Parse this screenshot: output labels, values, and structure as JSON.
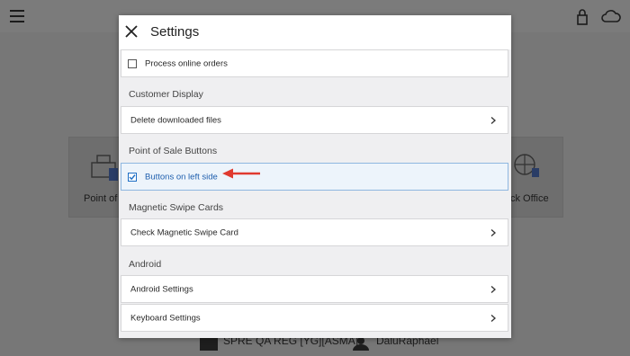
{
  "background": {
    "left_card_label": "Point of S",
    "right_card_label": "ck Office",
    "footer_store": "SPRE QA REG [YG][ASMA]",
    "footer_user": "DaluRaphael"
  },
  "dialog": {
    "title": "Settings",
    "rows": {
      "process_online_orders": "Process online orders",
      "delete_downloaded_files": "Delete downloaded files",
      "buttons_on_left_side": "Buttons on left side",
      "check_magnetic_swipe_card": "Check Magnetic Swipe Card",
      "android_settings": "Android Settings",
      "keyboard_settings": "Keyboard Settings"
    },
    "sections": {
      "customer_display": "Customer Display",
      "point_of_sale_buttons": "Point of Sale Buttons",
      "magnetic_swipe_cards": "Magnetic Swipe Cards",
      "android": "Android"
    },
    "checkbox_states": {
      "process_online_orders": false,
      "buttons_on_left_side": true
    }
  },
  "annotation": {
    "arrow_color": "#e03a2f"
  },
  "icons": [
    "menu-icon",
    "lock-icon",
    "cloud-icon",
    "close-icon",
    "chevron-right-icon",
    "store-icon",
    "user-icon"
  ],
  "colors": {
    "accent": "#1f6fc5",
    "selected_row_bg": "#edf4fb",
    "dialog_bg": "#efeff1",
    "overlay": "#7d7d7d"
  }
}
